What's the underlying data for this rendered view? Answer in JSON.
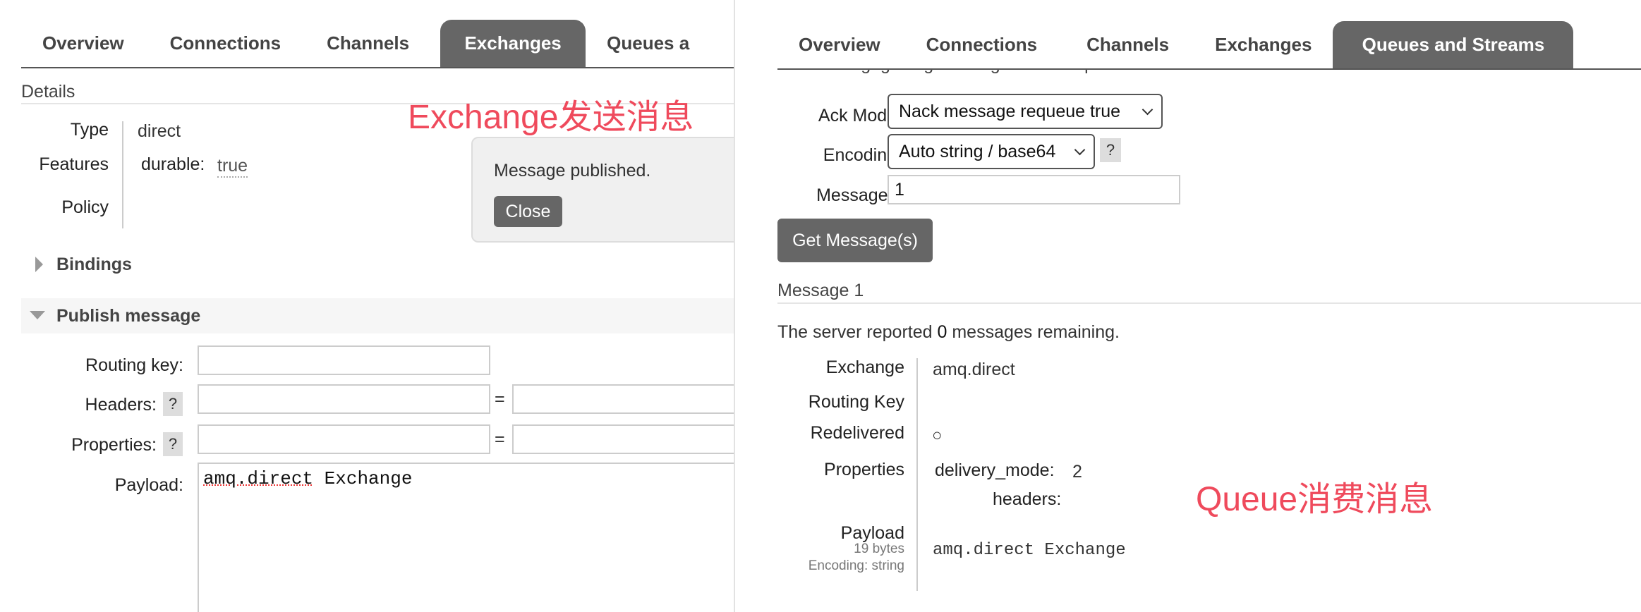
{
  "left": {
    "tabs": [
      "Overview",
      "Connections",
      "Channels",
      "Exchanges",
      "Queues a"
    ],
    "active_tab": "Exchanges",
    "details_label": "Details",
    "details": {
      "type_label": "Type",
      "type_value": "direct",
      "features_label": "Features",
      "durable_label": "durable:",
      "durable_value": "true",
      "policy_label": "Policy"
    },
    "annotation": "Exchange发送消息",
    "toast": {
      "message": "Message published.",
      "close_label": "Close"
    },
    "bindings_label": "Bindings",
    "publish_label": "Publish message",
    "form": {
      "routing_key_label": "Routing key:",
      "headers_label": "Headers:",
      "properties_label": "Properties:",
      "payload_label": "Payload:",
      "help_glyph": "?",
      "equals": "=",
      "routing_key_value": "",
      "payload_word1": "amq.direct",
      "payload_word2": " Exchange"
    }
  },
  "right": {
    "tabs": [
      "Overview",
      "Connections",
      "Channels",
      "Exchanges",
      "Queues and Streams"
    ],
    "active_tab": "Queues and Streams",
    "cut_warning": "Warning: getting messages from a queue is a destructive action.",
    "ack_mode_label": "Ack Mode:",
    "ack_mode_value": "Nack message requeue true",
    "encoding_label": "Encoding:",
    "encoding_value": "Auto string / base64",
    "help_glyph": "?",
    "messages_label": "Messages:",
    "messages_value": "1",
    "get_button": "Get Message(s)",
    "message_header": "Message 1",
    "server_text_pre": "The server reported ",
    "server_count": "0",
    "server_text_post": " messages remaining.",
    "exchange_label": "Exchange",
    "exchange_value": "amq.direct",
    "routing_key_label": "Routing Key",
    "redelivered_label": "Redelivered",
    "redelivered_value": "○",
    "properties_label": "Properties",
    "delivery_mode_label": "delivery_mode:",
    "delivery_mode_value": "2",
    "headers_label": "headers:",
    "payload_label": "Payload",
    "payload_size": "19 bytes",
    "payload_encoding": "Encoding: string",
    "payload_value": "amq.direct Exchange",
    "annotation": "Queue消费消息"
  }
}
